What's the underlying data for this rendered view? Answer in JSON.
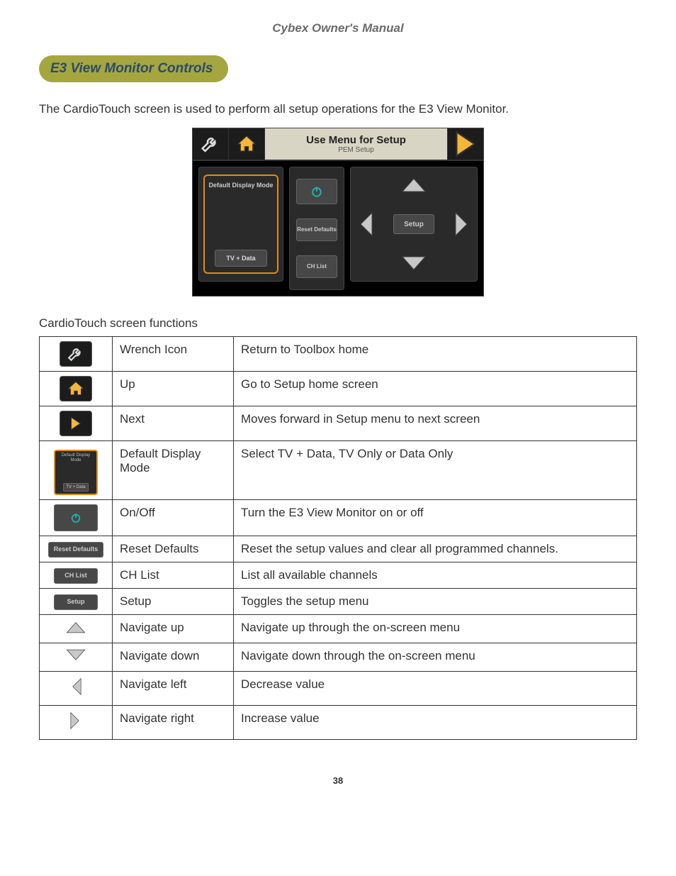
{
  "doc_title": "Cybex Owner's Manual",
  "section_title": "E3 View Monitor Controls",
  "intro_text": "The CardioTouch screen is used to perform all setup operations for the E3 View Monitor.",
  "screenshot": {
    "topbar_title": "Use Menu for Setup",
    "topbar_subtitle": "PEM Setup",
    "default_display_label": "Default Display Mode",
    "default_display_value": "TV + Data",
    "reset_defaults_label": "Reset Defaults",
    "ch_list_label": "CH List",
    "setup_label": "Setup"
  },
  "table_caption": "CardioTouch screen functions",
  "rows": [
    {
      "name": "Wrench Icon",
      "desc": "Return to Toolbox home"
    },
    {
      "name": "Up",
      "desc": "Go to Setup home screen"
    },
    {
      "name": "Next",
      "desc": "Moves forward in Setup menu to next screen"
    },
    {
      "name": "Default Display Mode",
      "desc": "Select TV + Data, TV Only or Data Only"
    },
    {
      "name": "On/Off",
      "desc": "Turn the E3 View Monitor on or off"
    },
    {
      "name": "Reset Defaults",
      "desc": "Reset the setup values and clear all programmed channels."
    },
    {
      "name": "CH List",
      "desc": "List all available channels"
    },
    {
      "name": "Setup",
      "desc": "Toggles the setup menu"
    },
    {
      "name": "Navigate up",
      "desc": "Navigate up through the on-screen menu"
    },
    {
      "name": "Navigate down",
      "desc": "Navigate down through the on-screen menu"
    },
    {
      "name": "Navigate left",
      "desc": "Decrease value"
    },
    {
      "name": "Navigate right",
      "desc": "Increase value"
    }
  ],
  "mini": {
    "default_label": "Default Display Mode",
    "default_value": "TV + Data",
    "reset_label": "Reset Defaults",
    "chlist_label": "CH List",
    "setup_label": "Setup"
  },
  "page_number": "38"
}
